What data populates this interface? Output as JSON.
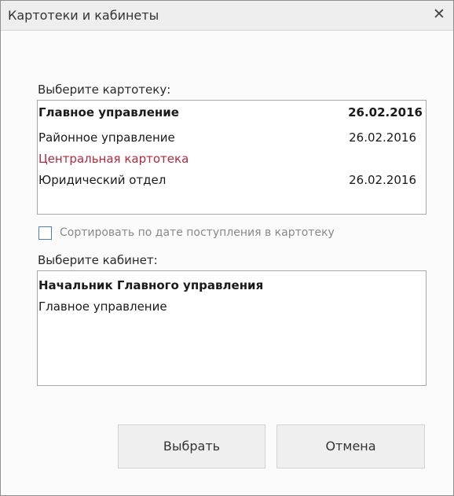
{
  "dialog": {
    "title": "Картотеки и кабинеты",
    "close_glyph": "✕"
  },
  "card_index": {
    "label": "Выберите картотеку:",
    "items": [
      {
        "name": "Главное управление",
        "date": "26.02.2016",
        "style": "bold"
      },
      {
        "name": "Районное управление",
        "date": "26.02.2016",
        "style": "normal"
      },
      {
        "name": "Центральная картотека",
        "date": "",
        "style": "red"
      },
      {
        "name": "Юридический отдел",
        "date": "26.02.2016",
        "style": "normal"
      }
    ]
  },
  "sort_option": {
    "label": "Сортировать по дате поступления в картотеку",
    "checked": false
  },
  "cabinet": {
    "label": "Выберите кабинет:",
    "items": [
      {
        "name": "Начальник Главного управления",
        "style": "bold"
      },
      {
        "name": "Главное управление",
        "style": "normal"
      }
    ]
  },
  "buttons": {
    "select_label": "Выбрать",
    "cancel_label": "Отмена"
  },
  "colors": {
    "accent_red": "#b02a3c",
    "checkbox_border": "#4a7fc1"
  }
}
